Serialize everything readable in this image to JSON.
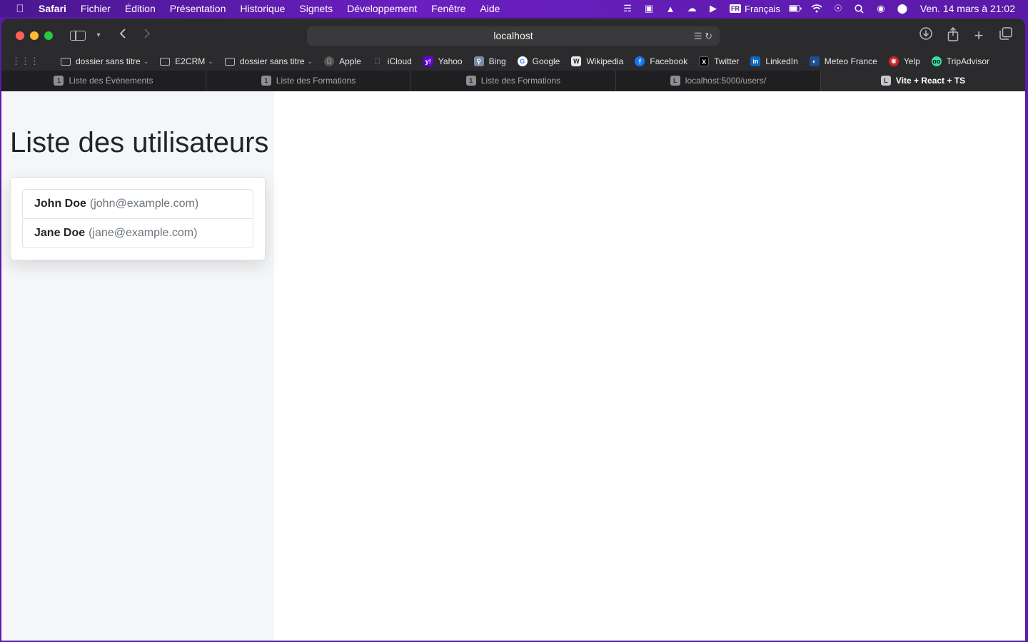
{
  "menubar": {
    "app": "Safari",
    "items": [
      "Fichier",
      "Édition",
      "Présentation",
      "Historique",
      "Signets",
      "Développement",
      "Fenêtre",
      "Aide"
    ],
    "language_flag": "FR",
    "language": "Français",
    "clock": "Ven. 14 mars à  21:02"
  },
  "browser": {
    "address": "localhost",
    "bookmarks": [
      {
        "label": "dossier sans titre",
        "icon": "folder-icon",
        "dropdown": true,
        "color": ""
      },
      {
        "label": "E2CRM",
        "icon": "folder-icon",
        "dropdown": true,
        "color": ""
      },
      {
        "label": "dossier sans titre",
        "icon": "folder-icon",
        "dropdown": true,
        "color": ""
      },
      {
        "label": "Apple",
        "icon": "apple-icon",
        "dropdown": false,
        "color": "#555555"
      },
      {
        "label": "iCloud",
        "icon": "apple-icon",
        "dropdown": false,
        "color": "#555555"
      },
      {
        "label": "Yahoo",
        "icon": "yahoo-icon",
        "dropdown": false,
        "color": "#6001d2"
      },
      {
        "label": "Bing",
        "icon": "bing-icon",
        "dropdown": false,
        "color": "#7a8aa8"
      },
      {
        "label": "Google",
        "icon": "google-icon",
        "dropdown": false,
        "color": "#4285f4"
      },
      {
        "label": "Wikipedia",
        "icon": "wikipedia-icon",
        "dropdown": false,
        "color": "#9a9a9a"
      },
      {
        "label": "Facebook",
        "icon": "facebook-icon",
        "dropdown": false,
        "color": "#1877f2"
      },
      {
        "label": "Twitter",
        "icon": "twitter-x-icon",
        "dropdown": false,
        "color": "#000000"
      },
      {
        "label": "LinkedIn",
        "icon": "linkedin-icon",
        "dropdown": false,
        "color": "#0a66c2"
      },
      {
        "label": "Meteo France",
        "icon": "meteo-france-icon",
        "dropdown": false,
        "color": "#1d4f91"
      },
      {
        "label": "Yelp",
        "icon": "yelp-icon",
        "dropdown": false,
        "color": "#d32323"
      },
      {
        "label": "TripAdvisor",
        "icon": "tripadvisor-icon",
        "dropdown": false,
        "color": "#34e0a1"
      }
    ],
    "tabs": [
      {
        "label": "Liste des Événements",
        "favicon": "1",
        "active": false
      },
      {
        "label": "Liste des Formations",
        "favicon": "1",
        "active": false
      },
      {
        "label": "Liste des Formations",
        "favicon": "1",
        "active": false
      },
      {
        "label": "localhost:5000/users/",
        "favicon": "L",
        "active": false
      },
      {
        "label": "Vite + React + TS",
        "favicon": "L",
        "active": true
      }
    ]
  },
  "page": {
    "title": "Liste des utilisateurs",
    "users": [
      {
        "name": "John Doe",
        "email": "(john@example.com)"
      },
      {
        "name": "Jane Doe",
        "email": "(jane@example.com)"
      }
    ]
  },
  "colors": {
    "accent": "#6a1fc0",
    "window_chrome": "#2b2b2d",
    "page_sidebar_bg": "#f5f6f8"
  }
}
